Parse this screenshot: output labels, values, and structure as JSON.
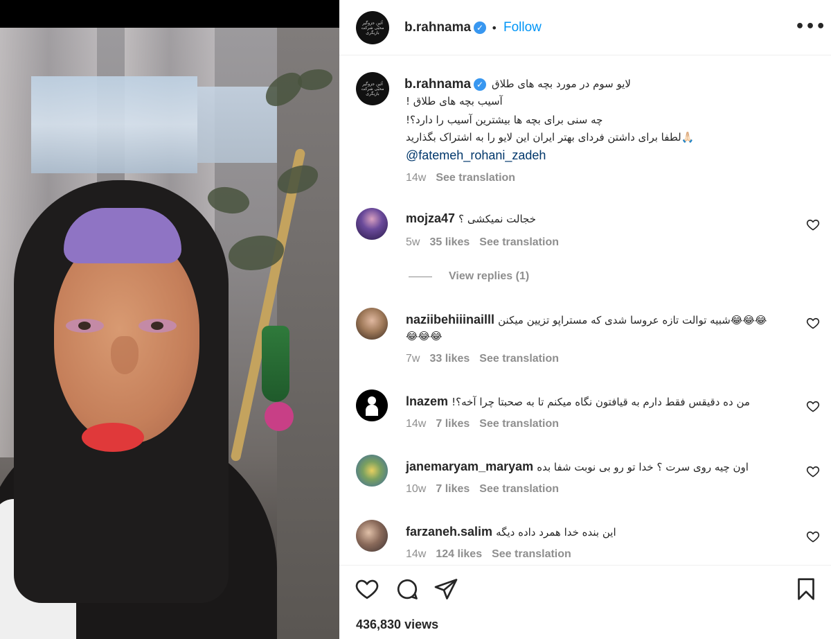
{
  "post": {
    "username": "b.rahnama",
    "verified_icon": "verified-badge-icon",
    "separator": "•",
    "follow_label": "Follow",
    "more_label": "•••",
    "avatar_text": "آئین جزوگیر\nمحبّی شرکت\nبازیگری"
  },
  "caption": {
    "username": "b.rahnama",
    "lines": [
      "لایو سوم در مورد بچه های طلاق",
      "آسیب بچه های طلاق !",
      "چه سنی برای بچه ها بیشترین آسیب را دارد؟!",
      "🙏🏻لطفا برای داشتن فردای بهتر ایران این لایو را به اشتراک بگذارید"
    ],
    "mention": "@fatemeh_rohani_zadeh",
    "age": "14w",
    "see_translation": "See translation"
  },
  "comments": [
    {
      "username": "mojza47",
      "text": "خجالت نمیکشی ؟",
      "age": "5w",
      "likes": "35 likes",
      "see_translation": "See translation",
      "view_replies": "View replies (1)",
      "avatar_color": "#4a3a7a"
    },
    {
      "username": "naziibehiiinailll",
      "text": "😂😂😂شبیه توالت تازه عروسا شدی که مستراپو تزیین میکنن",
      "text2": "😂😂😂",
      "age": "7w",
      "likes": "33 likes",
      "see_translation": "See translation",
      "avatar_color": "#a07a5a"
    },
    {
      "username": "lnazem",
      "text": "من ده دقیقس فقط دارم به قیافتون نگاه میکنم تا به صحبتا چرا آخه؟!",
      "age": "14w",
      "likes": "7 likes",
      "see_translation": "See translation",
      "avatar_color": "#000000"
    },
    {
      "username": "janemaryam_maryam",
      "text": "اون چیه روی سرت ؟ خدا تو رو بی نوبت شفا بده",
      "age": "10w",
      "likes": "7 likes",
      "see_translation": "See translation",
      "avatar_color": "#5a8a5a"
    },
    {
      "username": "farzaneh.salim",
      "text": "این بنده خدا همرد داده دیگه",
      "age": "14w",
      "likes": "124 likes",
      "see_translation": "See translation",
      "avatar_color": "#7a6a5a"
    }
  ],
  "actions": {
    "like_icon": "heart-icon",
    "comment_icon": "comment-icon",
    "share_icon": "share-icon",
    "save_icon": "bookmark-icon",
    "views": "436,830 views"
  },
  "colors": {
    "link_blue": "#0095f6",
    "mention_blue": "#00376b",
    "muted": "#8e8e8e",
    "verified": "#3897f0"
  }
}
